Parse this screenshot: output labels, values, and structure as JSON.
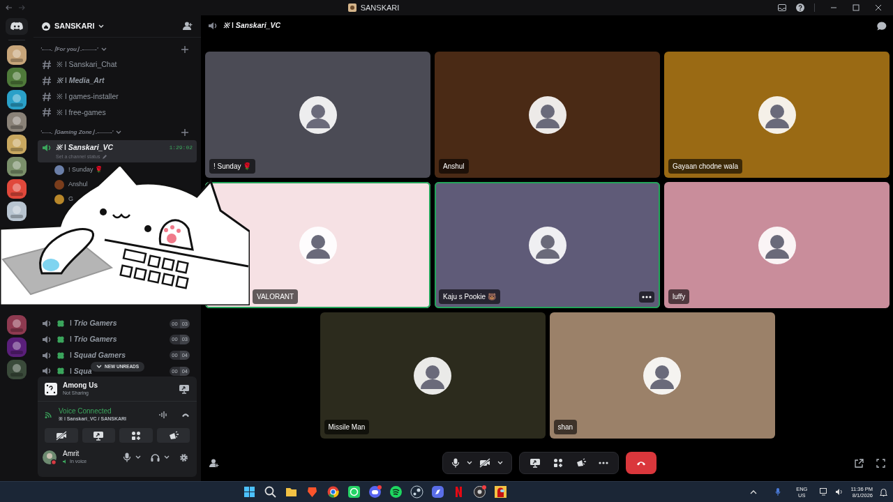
{
  "window": {
    "title": "SANSKARI"
  },
  "server": {
    "name": "SANSKARI"
  },
  "categories": [
    {
      "name": "'-—-. ⌈For you⌋ .-——-'",
      "channels": [
        {
          "kind": "text",
          "name": "※ ǀ Sanskari_Chat",
          "italic": false
        },
        {
          "kind": "text",
          "name": "※ ǀ Media_Art",
          "italic": true
        },
        {
          "kind": "text",
          "name": "※ ǀ games-installer",
          "italic": false
        },
        {
          "kind": "text",
          "name": "※ ǀ free-games",
          "italic": false
        }
      ]
    },
    {
      "name": "'-—-. ⌈Gaming Zone⌋ .-——-'",
      "channels": [
        {
          "kind": "active_voice",
          "name": "※ ǀ Sanskari_VC",
          "italic": true,
          "timer": "1:29:02",
          "status": "Set a channel status",
          "members": [
            {
              "name": "! Sunday 🌹",
              "color": "#6b7fa8"
            },
            {
              "name": "Anshul",
              "color": "#7a3d1c"
            },
            {
              "name": "G",
              "color": "#b8872a"
            }
          ]
        }
      ]
    }
  ],
  "more_channels": [
    {
      "name": "ǀ Trio Gamers",
      "users": "00",
      "limit": "03"
    },
    {
      "name": "ǀ Trio Gamers",
      "users": "00",
      "limit": "03"
    },
    {
      "name": "ǀ Squad Gamers",
      "users": "00",
      "limit": "04"
    },
    {
      "name": "ǀ Squa",
      "users": "00",
      "limit": "04"
    }
  ],
  "new_unreads": "NEW UNREADS",
  "activity": {
    "game": "Among Us",
    "status": "Not Sharing"
  },
  "voice": {
    "title": "Voice Connected",
    "channel": "※ ǀ Sanskari_VC / SANSKARI"
  },
  "user": {
    "name": "Amrit",
    "status": "In voice"
  },
  "call": {
    "title": "※ ǀ Sanskari_VC"
  },
  "tiles": [
    {
      "name": "! Sunday 🌹",
      "color": "#4b4b55",
      "speaking": false,
      "hovered": false
    },
    {
      "name": "Anshul",
      "color": "#4a2a15",
      "speaking": false,
      "hovered": false
    },
    {
      "name": "Gayaan chodne wala",
      "color": "#9a6a14",
      "speaking": false,
      "hovered": false
    },
    {
      "name": "VALORANT",
      "color": "#f6e1e4",
      "speaking": true,
      "hovered": false
    },
    {
      "name": "Kaju s Pookie 🐻",
      "color": "#5f5b78",
      "speaking": true,
      "hovered": true
    },
    {
      "name": "luffy",
      "color": "#c98d9b",
      "speaking": false,
      "hovered": false
    },
    {
      "name": "Missile Man",
      "color": "#2c2b1d",
      "speaking": false,
      "hovered": false
    },
    {
      "name": "shan",
      "color": "#9b8169",
      "speaking": false,
      "hovered": false
    }
  ],
  "clock": {
    "lang": "ENG",
    "region": "US",
    "time": "11:36 PM",
    "date": "8/1/2026"
  }
}
